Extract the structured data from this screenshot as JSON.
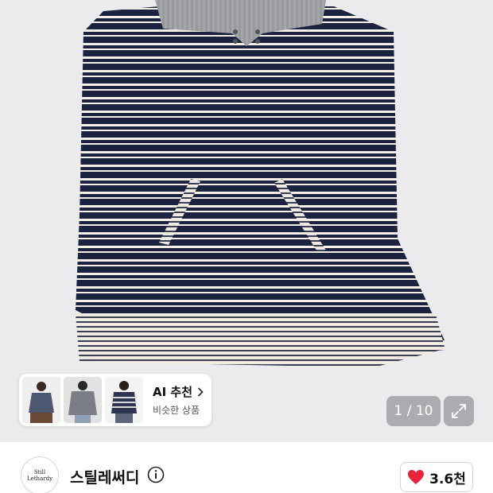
{
  "product_image": {
    "description_icon": "striped-hoodie-image",
    "colors": {
      "navy": "#1c2340",
      "cream": "#f3efe6",
      "gray_knit": "#9c9ea1",
      "background": "#ebebed"
    }
  },
  "ai_recommend": {
    "title": "AI 추천",
    "subtitle": "비슷한 상품",
    "chevron_icon": "chevron-right-icon"
  },
  "gallery": {
    "counter": "1 / 10",
    "expand_icon": "expand-icon"
  },
  "shop": {
    "logo_text": "Still Lethardy",
    "name": "스틸레써디",
    "info_icon": "info-icon"
  },
  "like": {
    "icon": "heart-icon",
    "count": "3.6천",
    "color": "#e8243b"
  }
}
